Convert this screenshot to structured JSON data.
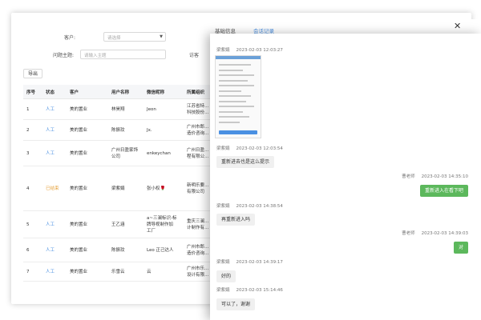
{
  "filters": {
    "customer_label": "客户:",
    "customer_placeholder": "请选择",
    "topic_label": "问题主题:",
    "topic_placeholder": "请输入主题",
    "visit_label": "访客"
  },
  "toolbar": {
    "export_label": "导出"
  },
  "table": {
    "headers": [
      "序号",
      "状态",
      "客户",
      "用户名称",
      "微信昵称",
      "所属组织"
    ],
    "rows": [
      {
        "index": "1",
        "status": "人工",
        "status_type": "link",
        "customer": "美的置业",
        "user": "林昊翔",
        "wechat": "Jeon",
        "org": "江苏省特…\n科技股份…"
      },
      {
        "index": "2",
        "status": "人工",
        "status_type": "link",
        "customer": "美的置业",
        "user": "陈振玟",
        "wechat": "Jx.",
        "org": "广州市郎…\n造价咨询…"
      },
      {
        "index": "3",
        "status": "人工",
        "status_type": "link",
        "customer": "美的置业",
        "user": "广州日盈家饰\n公司",
        "wechat": "enkeychan",
        "org": "广州日盈…\n程有限公…"
      },
      {
        "index": "4",
        "status": "已结束",
        "status_type": "warn",
        "customer": "美的置业",
        "user": "梁紫娟",
        "wechat": "张小权🌹",
        "org": "新明乐要…\n有限公司"
      },
      {
        "index": "5",
        "status": "人工",
        "status_type": "link",
        "customer": "美的置业",
        "user": "王乙涵",
        "wechat": "a~三澜标识-标\n牌导视制作加\n工厂",
        "org": "重庆三澜…\n计制作有…"
      },
      {
        "index": "6",
        "status": "人工",
        "status_type": "link",
        "customer": "美的置业",
        "user": "陈振玟",
        "wechat": "Leo 正己达人",
        "org": "广州市郎…\n造价咨询…"
      },
      {
        "index": "7",
        "status": "人工",
        "status_type": "link",
        "customer": "美的置业",
        "user": "乐雪云",
        "wechat": "云",
        "org": "广州市乐…\n设计有限…"
      }
    ]
  },
  "drawer": {
    "tabs": [
      "基础信息",
      "会话记录"
    ],
    "active_tab": 1,
    "close_symbol": "✕",
    "messages": [
      {
        "side": "left",
        "sender": "梁紫娟",
        "time": "2023-02-03 12:03:27",
        "type": "image"
      },
      {
        "side": "left",
        "sender": "梁紫娟",
        "time": "2023-02-03 12:03:54",
        "type": "text",
        "text": "重新进去也是这么提示"
      },
      {
        "side": "right",
        "sender": "曹老师",
        "time": "2023-02-03 14:35:10",
        "type": "text",
        "text": "重新进入在看下吧"
      },
      {
        "side": "left",
        "sender": "梁紫娟",
        "time": "2023-02-03 14:38:54",
        "type": "text",
        "text": "再重新进入吗"
      },
      {
        "side": "right",
        "sender": "曹老师",
        "time": "2023-02-03 14:39:03",
        "type": "text",
        "text": "对"
      },
      {
        "side": "left",
        "sender": "梁紫娟",
        "time": "2023-02-03 14:39:17",
        "type": "text",
        "text": "好的"
      },
      {
        "side": "left",
        "sender": "梁紫娟",
        "time": "2023-02-03 15:14:46",
        "type": "text",
        "text": "可以了，谢谢"
      }
    ]
  },
  "colors": {
    "accent": "#4a90e2",
    "bubble_right": "#5cb85c",
    "bubble_left": "#f0f0f0",
    "warn": "#e6a23c"
  }
}
